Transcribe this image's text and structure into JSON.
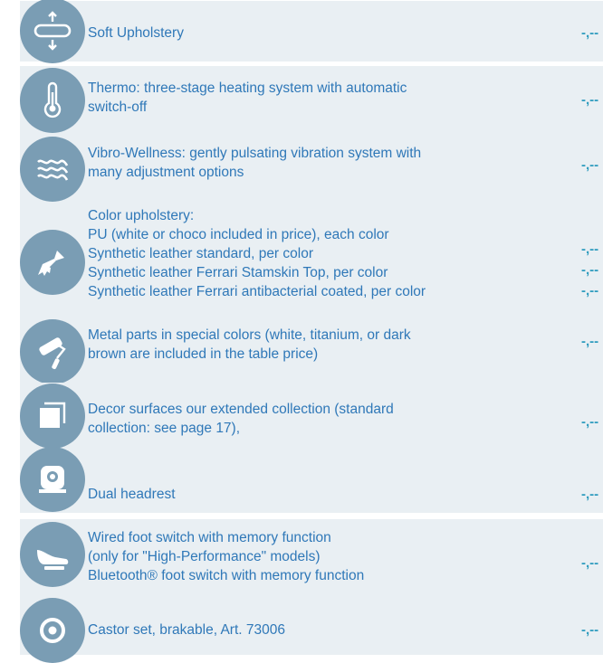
{
  "items": [
    {
      "icon": "soft-upholstery-icon",
      "lines": [
        "Soft Upholstery"
      ],
      "prices": [
        "-,--"
      ]
    },
    {
      "icon": "thermometer-icon",
      "lines": [
        "Thermo: three-stage heating system with automatic",
        "switch-off"
      ],
      "prices": [
        "-,--"
      ]
    },
    {
      "icon": "vibration-waves-icon",
      "lines": [
        "Vibro-Wellness: gently pulsating vibration system with",
        "many adjustment options"
      ],
      "prices": [
        "-,--"
      ]
    },
    {
      "icon": "paintbrush-icon",
      "lines": [
        "Color upholstery:",
        "PU (white or choco included in price), each color",
        "Synthetic leather standard, per color",
        "Synthetic leather Ferrari Stamskin Top, per color",
        "Synthetic leather Ferrari antibacterial coated, per color"
      ],
      "prices": [
        "-,--",
        "-,--",
        "-,--"
      ]
    },
    {
      "icon": "paint-roller-icon",
      "lines": [
        "Metal parts in special colors (white, titanium, or dark",
        "brown are included in the table price)"
      ],
      "prices": [
        "-,--"
      ]
    },
    {
      "icon": "decor-surfaces-icon",
      "lines": [
        "Decor surfaces  our extended collection (standard",
        "collection: see page 17),"
      ],
      "prices": [
        "-,--"
      ]
    },
    {
      "icon": "headrest-icon",
      "lines": [
        "Dual headrest"
      ],
      "prices": [
        "-,--"
      ]
    },
    {
      "icon": "foot-switch-icon",
      "lines": [
        "Wired foot switch with memory function",
        "(only for \"High-Performance\" models)",
        "Bluetooth® foot switch with memory function"
      ],
      "prices": [
        "-,--"
      ]
    },
    {
      "icon": "castor-icon",
      "lines": [
        "Castor set, brakable, Art. 73006"
      ],
      "prices": [
        "-,--"
      ]
    }
  ]
}
